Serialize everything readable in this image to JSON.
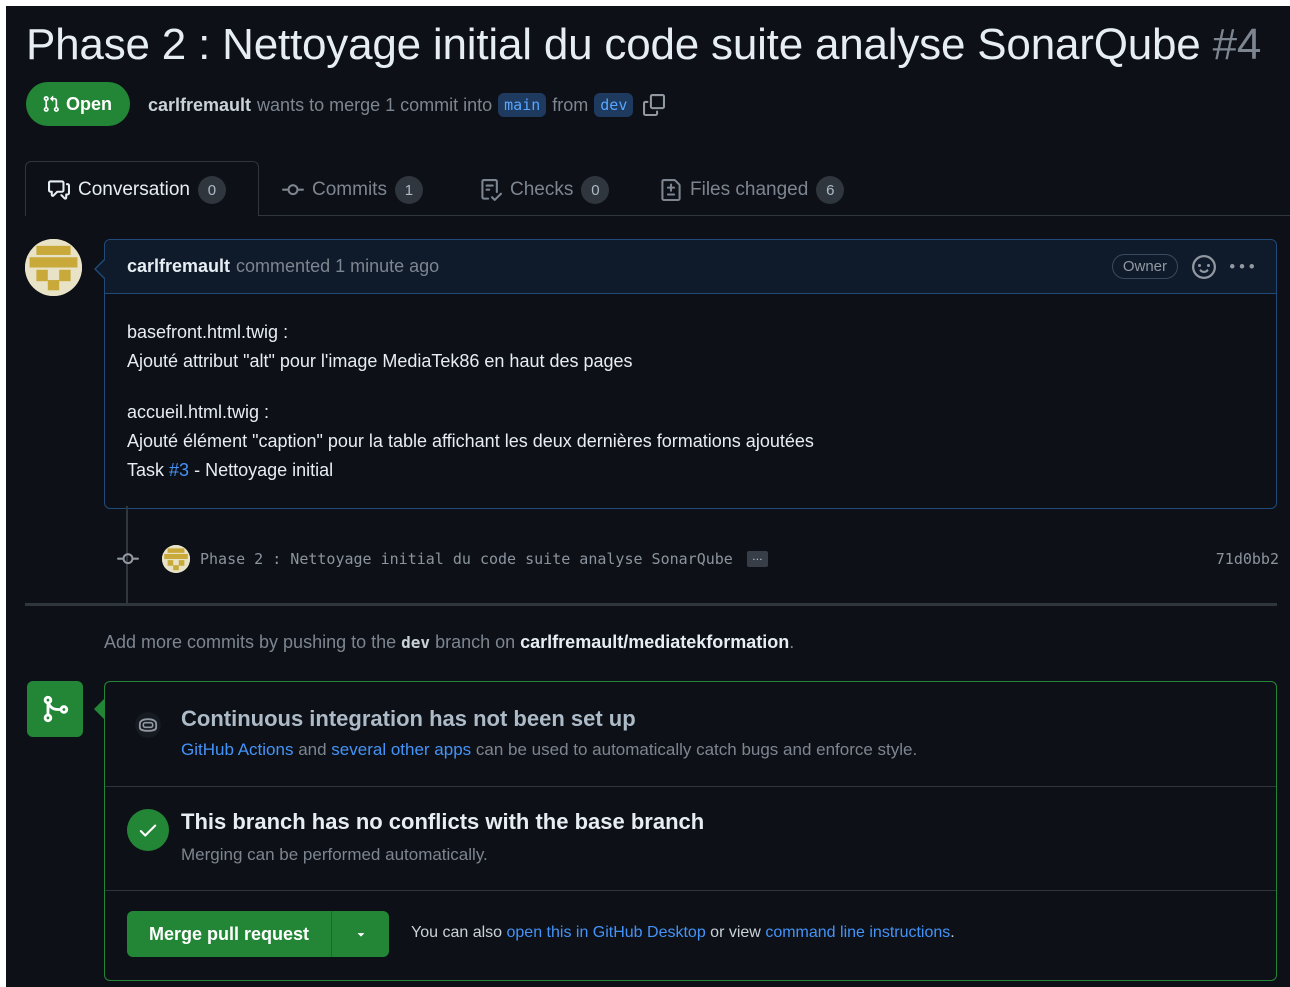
{
  "pr": {
    "title": "Phase 2 : Nettoyage initial du code suite analyse SonarQube",
    "number": "#4",
    "state": "Open",
    "author": "carlfremault",
    "merge_text": "wants to merge 1 commit into",
    "base_branch": "main",
    "from_text": "from",
    "head_branch": "dev"
  },
  "tabs": [
    {
      "label": "Conversation",
      "count": "0",
      "icon": "comment-discussion-icon"
    },
    {
      "label": "Commits",
      "count": "1",
      "icon": "git-commit-icon"
    },
    {
      "label": "Checks",
      "count": "0",
      "icon": "checklist-icon"
    },
    {
      "label": "Files changed",
      "count": "6",
      "icon": "file-diff-icon"
    }
  ],
  "comment": {
    "author": "carlfremault",
    "action": "commented 1 minute ago",
    "role": "Owner",
    "lines": [
      "basefront.html.twig :",
      "Ajouté attribut \"alt\" pour l'image MediaTek86 en haut des pages",
      "accueil.html.twig :",
      "Ajouté élément \"caption\" pour la table affichant les deux dernières formations ajoutées"
    ],
    "task_prefix": "Task",
    "task_ref": "#3",
    "task_suffix": "- Nettoyage initial"
  },
  "commit": {
    "message": "Phase 2 : Nettoyage initial du code suite analyse SonarQube",
    "ellipsis": "…",
    "sha": "71d0bb2"
  },
  "push_hint": {
    "prefix": "Add more commits by pushing to the",
    "branch": "dev",
    "middle": "branch on",
    "repo": "carlfremault/mediatekformation",
    "suffix": "."
  },
  "merge_box": {
    "ci_title": "Continuous integration has not been set up",
    "ci_link1": "GitHub Actions",
    "ci_and": "and",
    "ci_link2": "several other apps",
    "ci_rest": "can be used to automatically catch bugs and enforce style.",
    "conflict_title": "This branch has no conflicts with the base branch",
    "conflict_sub": "Merging can be performed automatically.",
    "merge_button": "Merge pull request",
    "also_prefix": "You can also",
    "also_link1": "open this in GitHub Desktop",
    "also_mid": "or view",
    "also_link2": "command line instructions",
    "also_suffix": "."
  },
  "colors": {
    "background": "#0d1117",
    "accent_green": "#238636",
    "link_blue": "#4493f8",
    "muted_text": "#7d8590"
  }
}
